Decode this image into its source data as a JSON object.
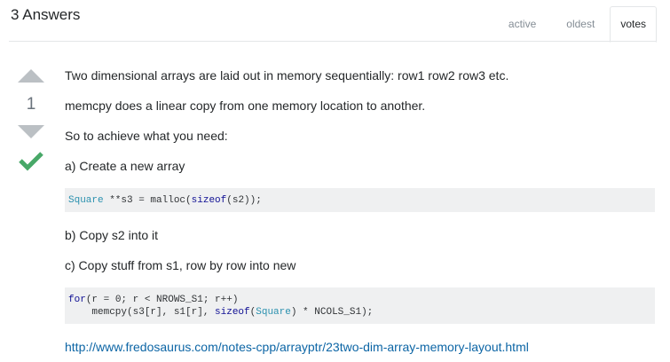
{
  "header": {
    "answers_count_label": "3 Answers",
    "tabs": [
      {
        "label": "active",
        "selected": false
      },
      {
        "label": "oldest",
        "selected": false
      },
      {
        "label": "votes",
        "selected": true
      }
    ]
  },
  "answer": {
    "vote_count": "1",
    "accepted": true,
    "paragraphs": {
      "p1": "Two dimensional arrays are laid out in memory sequentially: row1 row2 row3 etc.",
      "p2": "memcpy does a linear copy from one memory location to another.",
      "p3": "So to achieve what you need:",
      "p4": "a) Create a new array",
      "p5": "b) Copy s2 into it",
      "p6": "c) Copy stuff from s1, row by row into new"
    },
    "code1": {
      "t1": "Square",
      "t2": " **s3 = malloc(",
      "t3": "sizeof",
      "t4": "(s2));"
    },
    "code2": {
      "l1a": "for",
      "l1b": "(r = 0; r < NROWS_S1; r++)",
      "l2a": "    memcpy(s3[r], s1[r], ",
      "l2b": "sizeof",
      "l2c": "(",
      "l2d": "Square",
      "l2e": ") * NCOLS_S1);"
    },
    "link_text": "http://www.fredosaurus.com/notes-cpp/arrayptr/23two-dim-array-memory-layout.html"
  },
  "colors": {
    "link": "#0c65a5",
    "accepted": "#48a868",
    "vote_arrow": "#bbc0c4"
  }
}
